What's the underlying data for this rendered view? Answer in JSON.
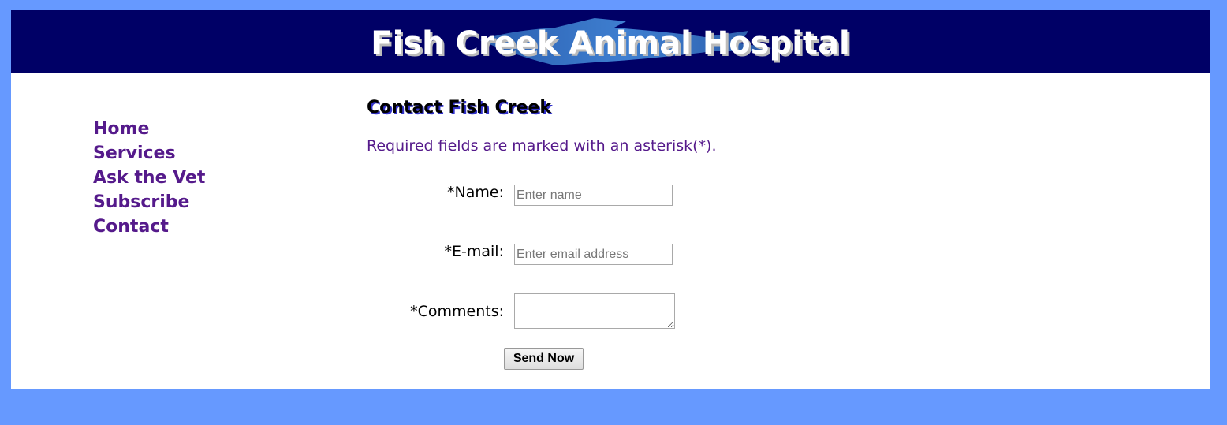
{
  "header": {
    "title": "Fish Creek Animal Hospital"
  },
  "nav": {
    "items": [
      {
        "label": "Home"
      },
      {
        "label": "Services"
      },
      {
        "label": "Ask the Vet"
      },
      {
        "label": "Subscribe"
      },
      {
        "label": "Contact"
      }
    ]
  },
  "main": {
    "heading": "Contact Fish Creek",
    "required_note": "Required fields are marked with an asterisk(*).",
    "form": {
      "name_label": "*Name:",
      "name_placeholder": "Enter name",
      "name_value": "",
      "email_label": "*E-mail:",
      "email_placeholder": "Enter email address",
      "email_value": "",
      "comments_label": "*Comments:",
      "comments_value": "",
      "submit_label": "Send Now"
    }
  },
  "colors": {
    "background": "#6699ff",
    "header": "#000066",
    "link": "#551a8b"
  }
}
